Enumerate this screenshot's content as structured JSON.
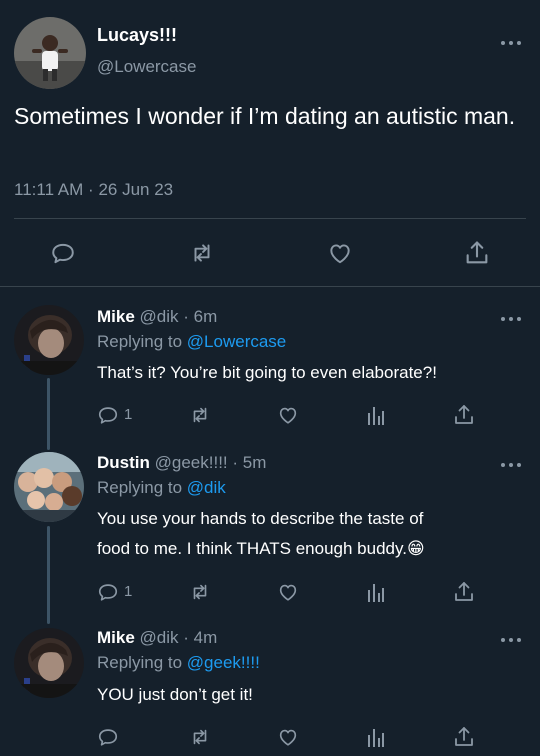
{
  "main_tweet": {
    "display_name": "Lucays!!!",
    "handle": "@Lowercase",
    "text": "Sometimes I wonder if I’m dating an autistic man.",
    "time": "11:11 AM",
    "separator": "·",
    "date": "26 Jun 23"
  },
  "replies": [
    {
      "display_name": "Mike",
      "handle": "@dik",
      "separator": "·",
      "age": "6m",
      "replying_label": "Replying to",
      "replying_to": "@Lowercase",
      "text": "That’s it? You’re bit going to even elaborate?!",
      "reply_count": "1"
    },
    {
      "display_name": "Dustin",
      "handle": "@geek!!!!",
      "separator": "·",
      "age": "5m",
      "replying_label": "Replying to",
      "replying_to": "@dik",
      "text_line1": "You use your hands to describe the taste of",
      "text_line2": "food to me. I think THATS enough buddy.",
      "emoji": "😁",
      "reply_count": "1"
    },
    {
      "display_name": "Mike",
      "handle": "@dik",
      "separator": "·",
      "age": "4m",
      "replying_label": "Replying to",
      "replying_to": "@geek!!!!",
      "text": "YOU just don’t get it!"
    }
  ],
  "colors": {
    "background": "#15202b",
    "muted_text": "#8b98a5",
    "link": "#1d9bf0",
    "divider": "#38444d"
  }
}
